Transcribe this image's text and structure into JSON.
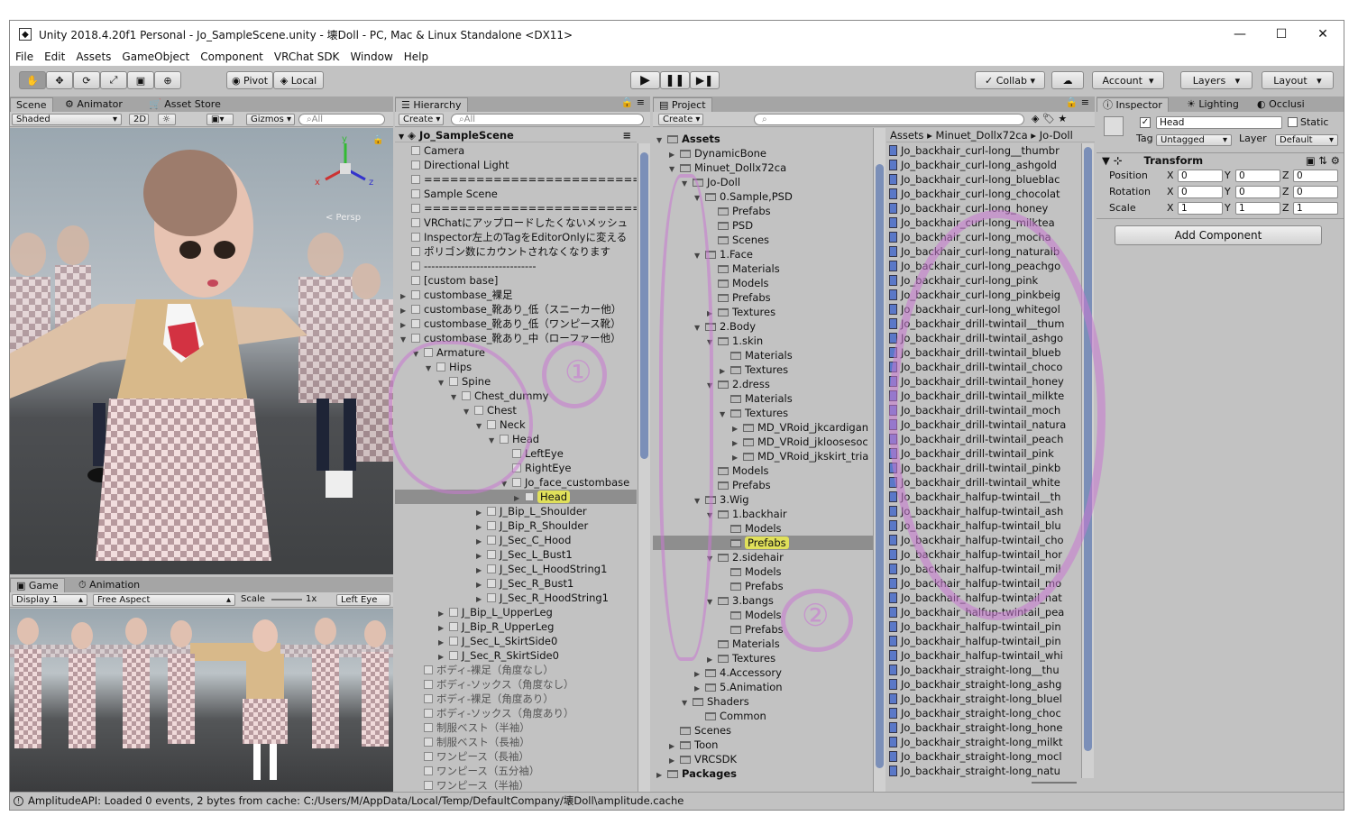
{
  "window": {
    "title": "Unity 2018.4.20f1 Personal - Jo_SampleScene.unity - 壊Doll - PC, Mac & Linux Standalone <DX11>",
    "min": "—",
    "max": "☐",
    "close": "✕"
  },
  "menu": [
    "File",
    "Edit",
    "Assets",
    "GameObject",
    "Component",
    "VRChat SDK",
    "Window",
    "Help"
  ],
  "toolbar": {
    "pivot": "Pivot",
    "local": "Local",
    "collab": "Collab",
    "account": "Account",
    "layers": "Layers",
    "layout": "Layout"
  },
  "scene": {
    "tabs": [
      "Scene",
      "Animator",
      "Asset Store"
    ],
    "shading": "Shaded",
    "mode2d": "2D",
    "gizmos": "Gizmos",
    "search": "All",
    "persp": "< Persp"
  },
  "game": {
    "tabs": [
      "Game",
      "Animation"
    ],
    "display": "Display 1",
    "aspect": "Free Aspect",
    "scale_label": "Scale",
    "scale_value": "1x",
    "eye": "Left Eye"
  },
  "hierarchy": {
    "tab": "Hierarchy",
    "create": "Create",
    "search": "All",
    "scene_name": "Jo_SampleScene",
    "rows": [
      {
        "t": "Camera",
        "d": 1,
        "a": ""
      },
      {
        "t": "Directional Light",
        "d": 1,
        "a": ""
      },
      {
        "t": "==============================",
        "d": 1,
        "a": ""
      },
      {
        "t": "Sample Scene",
        "d": 1,
        "a": ""
      },
      {
        "t": "==============================",
        "d": 1,
        "a": ""
      },
      {
        "t": "VRChatにアップロードしたくないメッシュ",
        "d": 1,
        "a": ""
      },
      {
        "t": "Inspector左上のTagをEditorOnlyに変える",
        "d": 1,
        "a": ""
      },
      {
        "t": "ポリゴン数にカウントされなくなります",
        "d": 1,
        "a": ""
      },
      {
        "t": "------------------------------",
        "d": 1,
        "a": ""
      },
      {
        "t": "[custom base]",
        "d": 1,
        "a": ""
      },
      {
        "t": "custombase_裸足",
        "d": 1,
        "a": "▶"
      },
      {
        "t": "custombase_靴あり_低（スニーカー他）",
        "d": 1,
        "a": "▶"
      },
      {
        "t": "custombase_靴あり_低（ワンピース靴）",
        "d": 1,
        "a": "▶"
      },
      {
        "t": "custombase_靴あり_中（ローファー他）",
        "d": 1,
        "a": "▼"
      },
      {
        "t": "Armature",
        "d": 2,
        "a": "▼"
      },
      {
        "t": "Hips",
        "d": 3,
        "a": "▼"
      },
      {
        "t": "Spine",
        "d": 4,
        "a": "▼"
      },
      {
        "t": "Chest_dummy",
        "d": 5,
        "a": "▼"
      },
      {
        "t": "Chest",
        "d": 6,
        "a": "▼"
      },
      {
        "t": "Neck",
        "d": 7,
        "a": "▼"
      },
      {
        "t": "Head",
        "d": 8,
        "a": "▼"
      },
      {
        "t": "LeftEye",
        "d": 9,
        "a": ""
      },
      {
        "t": "RightEye",
        "d": 9,
        "a": ""
      },
      {
        "t": "Jo_face_custombase",
        "d": 9,
        "a": "▼"
      },
      {
        "t": "Head",
        "d": 10,
        "a": "▶",
        "sel": true
      },
      {
        "t": "J_Bip_L_Shoulder",
        "d": 7,
        "a": "▶"
      },
      {
        "t": "J_Bip_R_Shoulder",
        "d": 7,
        "a": "▶"
      },
      {
        "t": "J_Sec_C_Hood",
        "d": 7,
        "a": "▶"
      },
      {
        "t": "J_Sec_L_Bust1",
        "d": 7,
        "a": "▶"
      },
      {
        "t": "J_Sec_L_HoodString1",
        "d": 7,
        "a": "▶"
      },
      {
        "t": "J_Sec_R_Bust1",
        "d": 7,
        "a": "▶"
      },
      {
        "t": "J_Sec_R_HoodString1",
        "d": 7,
        "a": "▶"
      },
      {
        "t": "J_Bip_L_UpperLeg",
        "d": 4,
        "a": "▶"
      },
      {
        "t": "J_Bip_R_UpperLeg",
        "d": 4,
        "a": "▶"
      },
      {
        "t": "J_Sec_L_SkirtSide0",
        "d": 4,
        "a": "▶"
      },
      {
        "t": "J_Sec_R_SkirtSide0",
        "d": 4,
        "a": "▶"
      },
      {
        "t": "ボディ-裸足（角度なし）",
        "d": 2,
        "a": ""
      },
      {
        "t": "ボディ-ソックス（角度なし）",
        "d": 2,
        "a": ""
      },
      {
        "t": "ボディ-裸足（角度あり）",
        "d": 2,
        "a": ""
      },
      {
        "t": "ボディ-ソックス（角度あり）",
        "d": 2,
        "a": ""
      },
      {
        "t": "制服ベスト（半袖）",
        "d": 2,
        "a": ""
      },
      {
        "t": "制服ベスト（長袖）",
        "d": 2,
        "a": ""
      },
      {
        "t": "ワンピース（長袖）",
        "d": 2,
        "a": ""
      },
      {
        "t": "ワンピース（五分袖）",
        "d": 2,
        "a": ""
      },
      {
        "t": "ワンピース（半袖）",
        "d": 2,
        "a": ""
      }
    ]
  },
  "project": {
    "tab": "Project",
    "create": "Create",
    "tree": [
      {
        "t": "Assets",
        "d": 0,
        "a": "▼",
        "b": true
      },
      {
        "t": "DynamicBone",
        "d": 1,
        "a": "▶"
      },
      {
        "t": "Minuet_Dollx72ca",
        "d": 1,
        "a": "▼"
      },
      {
        "t": "Jo-Doll",
        "d": 2,
        "a": "▼"
      },
      {
        "t": "0.Sample,PSD",
        "d": 3,
        "a": "▼"
      },
      {
        "t": "Prefabs",
        "d": 4,
        "a": ""
      },
      {
        "t": "PSD",
        "d": 4,
        "a": ""
      },
      {
        "t": "Scenes",
        "d": 4,
        "a": ""
      },
      {
        "t": "1.Face",
        "d": 3,
        "a": "▼"
      },
      {
        "t": "Materials",
        "d": 4,
        "a": ""
      },
      {
        "t": "Models",
        "d": 4,
        "a": ""
      },
      {
        "t": "Prefabs",
        "d": 4,
        "a": ""
      },
      {
        "t": "Textures",
        "d": 4,
        "a": "▶"
      },
      {
        "t": "2.Body",
        "d": 3,
        "a": "▼"
      },
      {
        "t": "1.skin",
        "d": 4,
        "a": "▼"
      },
      {
        "t": "Materials",
        "d": 5,
        "a": ""
      },
      {
        "t": "Textures",
        "d": 5,
        "a": "▶"
      },
      {
        "t": "2.dress",
        "d": 4,
        "a": "▼"
      },
      {
        "t": "Materials",
        "d": 5,
        "a": ""
      },
      {
        "t": "Textures",
        "d": 5,
        "a": "▼"
      },
      {
        "t": "MD_VRoid_jkcardigan",
        "d": 6,
        "a": "▶"
      },
      {
        "t": "MD_VRoid_jkloosesoc",
        "d": 6,
        "a": "▶"
      },
      {
        "t": "MD_VRoid_jkskirt_tria",
        "d": 6,
        "a": "▶"
      },
      {
        "t": "Models",
        "d": 4,
        "a": ""
      },
      {
        "t": "Prefabs",
        "d": 4,
        "a": ""
      },
      {
        "t": "3.Wig",
        "d": 3,
        "a": "▼"
      },
      {
        "t": "1.backhair",
        "d": 4,
        "a": "▼"
      },
      {
        "t": "Models",
        "d": 5,
        "a": ""
      },
      {
        "t": "Prefabs",
        "d": 5,
        "a": "",
        "sel": true
      },
      {
        "t": "2.sidehair",
        "d": 4,
        "a": "▼"
      },
      {
        "t": "Models",
        "d": 5,
        "a": ""
      },
      {
        "t": "Prefabs",
        "d": 5,
        "a": ""
      },
      {
        "t": "3.bangs",
        "d": 4,
        "a": "▼"
      },
      {
        "t": "Models",
        "d": 5,
        "a": ""
      },
      {
        "t": "Prefabs",
        "d": 5,
        "a": ""
      },
      {
        "t": "Materials",
        "d": 4,
        "a": ""
      },
      {
        "t": "Textures",
        "d": 4,
        "a": "▶"
      },
      {
        "t": "4.Accessory",
        "d": 3,
        "a": "▶"
      },
      {
        "t": "5.Animation",
        "d": 3,
        "a": "▶"
      },
      {
        "t": "Shaders",
        "d": 2,
        "a": "▼"
      },
      {
        "t": "Common",
        "d": 3,
        "a": ""
      },
      {
        "t": "Scenes",
        "d": 1,
        "a": ""
      },
      {
        "t": "Toon",
        "d": 1,
        "a": "▶"
      },
      {
        "t": "VRCSDK",
        "d": 1,
        "a": "▶"
      },
      {
        "t": "Packages",
        "d": 0,
        "a": "▶",
        "b": true
      }
    ],
    "breadcrumb": [
      "Assets",
      "Minuet_Dollx72ca",
      "Jo-Doll"
    ],
    "files": [
      "Jo_backhair_curl-long__thumbr",
      "Jo_backhair_curl-long_ashgold",
      "Jo_backhair_curl-long_blueblac",
      "Jo_backhair_curl-long_chocolat",
      "Jo_backhair_curl-long_honey",
      "Jo_backhair_curl-long_milktea",
      "Jo_backhair_curl-long_mocha",
      "Jo_backhair_curl-long_naturalb",
      "Jo_backhair_curl-long_peachgo",
      "Jo_backhair_curl-long_pink",
      "Jo_backhair_curl-long_pinkbeig",
      "Jo_backhair_curl-long_whitegol",
      "Jo_backhair_drill-twintail__thum",
      "Jo_backhair_drill-twintail_ashgo",
      "Jo_backhair_drill-twintail_blueb",
      "Jo_backhair_drill-twintail_choco",
      "Jo_backhair_drill-twintail_honey",
      "Jo_backhair_drill-twintail_milkte",
      "Jo_backhair_drill-twintail_moch",
      "Jo_backhair_drill-twintail_natura",
      "Jo_backhair_drill-twintail_peach",
      "Jo_backhair_drill-twintail_pink",
      "Jo_backhair_drill-twintail_pinkb",
      "Jo_backhair_drill-twintail_white",
      "Jo_backhair_halfup-twintail__th",
      "Jo_backhair_halfup-twintail_ash",
      "Jo_backhair_halfup-twintail_blu",
      "Jo_backhair_halfup-twintail_cho",
      "Jo_backhair_halfup-twintail_hor",
      "Jo_backhair_halfup-twintail_mil",
      "Jo_backhair_halfup-twintail_mo",
      "Jo_backhair_halfup-twintail_nat",
      "Jo_backhair_halfup-twintail_pea",
      "Jo_backhair_halfup-twintail_pin",
      "Jo_backhair_halfup-twintail_pin",
      "Jo_backhair_halfup-twintail_whi",
      "Jo_backhair_straight-long__thu",
      "Jo_backhair_straight-long_ashg",
      "Jo_backhair_straight-long_bluel",
      "Jo_backhair_straight-long_choc",
      "Jo_backhair_straight-long_hone",
      "Jo_backhair_straight-long_milkt",
      "Jo_backhair_straight-long_mocl",
      "Jo_backhair_straight-long_natu"
    ]
  },
  "inspector": {
    "tabs": [
      "Inspector",
      "Lighting",
      "Occlusi"
    ],
    "name": "Head",
    "static": "Static",
    "tag_label": "Tag",
    "tag": "Untagged",
    "layer_label": "Layer",
    "layer": "Default",
    "transform": "Transform",
    "rows": [
      {
        "label": "Position",
        "x": "0",
        "y": "0",
        "z": "0"
      },
      {
        "label": "Rotation",
        "x": "0",
        "y": "0",
        "z": "0"
      },
      {
        "label": "Scale",
        "x": "1",
        "y": "1",
        "z": "1"
      }
    ],
    "axes": [
      "X",
      "Y",
      "Z"
    ],
    "add_component": "Add Component"
  },
  "annotations": [
    "①",
    "②"
  ],
  "status": "AmplitudeAPI: Loaded 0 events, 2 bytes from cache: C:/Users/M/AppData/Local/Temp/DefaultCompany/壊Doll\\amplitude.cache"
}
